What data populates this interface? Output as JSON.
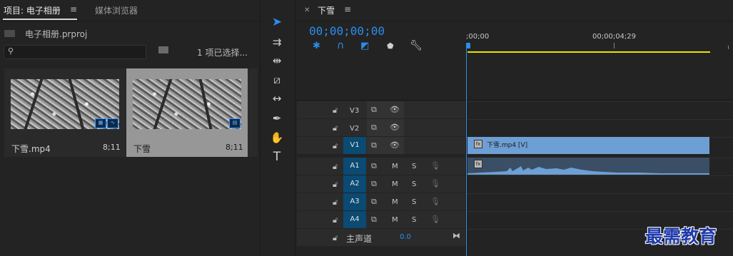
{
  "project_panel": {
    "tabs": [
      "项目: 电子相册",
      "媒体浏览器"
    ],
    "menu_icon": "hamburger-menu-icon",
    "project_file": "电子相册.prproj",
    "search_placeholder": "",
    "selection_status": "1 项已选择...",
    "clips": [
      {
        "name": "下雪.mp4",
        "duration": "8;11"
      },
      {
        "name": "下雪",
        "duration": "8;11"
      }
    ]
  },
  "tools": [
    "selection-tool-icon",
    "track-select-tool-icon",
    "ripple-edit-tool-icon",
    "razor-tool-icon",
    "slip-tool-icon",
    "pen-tool-icon",
    "hand-tool-icon",
    "type-tool-icon"
  ],
  "timeline": {
    "sequence_name": "下雪",
    "timecode": "00;00;00;00",
    "ruler_ticks": [
      ";00;00",
      "00;00;04;29"
    ],
    "video_tracks": [
      "V3",
      "V2",
      "V1"
    ],
    "audio_tracks": [
      "A1",
      "A2",
      "A3",
      "A4"
    ],
    "mute_label": "M",
    "solo_label": "S",
    "master_label": "主声道",
    "master_value": "0.0",
    "video_clip_label": "下雪.mp4 [V]",
    "fx_label": "fx"
  },
  "watermark": "最需教育",
  "colors": {
    "accent": "#2d8ceb",
    "selected_track": "#0a4a73",
    "video_clip": "#6d9fd4",
    "audio_clip": "#3a4e66",
    "work_area": "#e6e600"
  }
}
